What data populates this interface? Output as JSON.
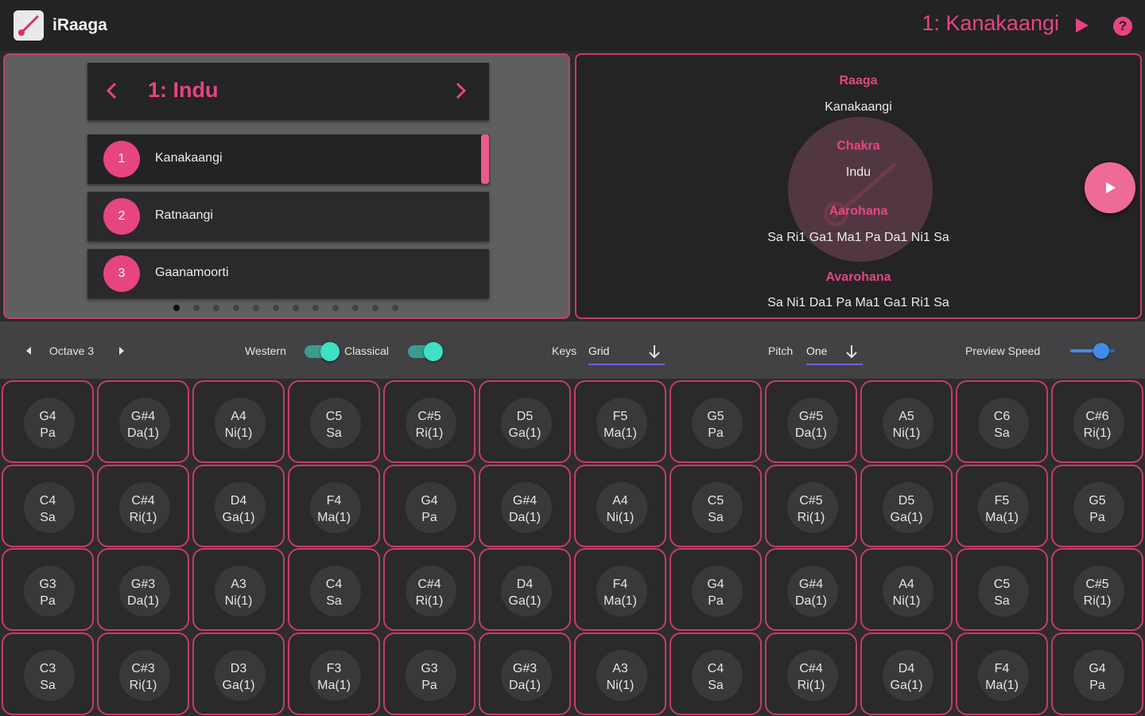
{
  "app": {
    "name": "iRaaga",
    "current_raaga": "1: Kanakaangi"
  },
  "chakra_nav": {
    "title": "1: Indu"
  },
  "raaga_list": [
    {
      "number": "1",
      "name": "Kanakaangi",
      "selected": true
    },
    {
      "number": "2",
      "name": "Ratnaangi",
      "selected": false
    },
    {
      "number": "3",
      "name": "Gaanamoorti",
      "selected": false
    }
  ],
  "pager": {
    "count": 12,
    "active_index": 0
  },
  "info": {
    "raaga_label": "Raaga",
    "raaga_value": "Kanakaangi",
    "chakra_label": "Chakra",
    "chakra_value": "Indu",
    "aarohana_label": "Aarohana",
    "aarohana_value": "Sa Ri1 Ga1 Ma1 Pa Da1 Ni1 Sa",
    "avarohana_label": "Avarohana",
    "avarohana_value": "Sa Ni1 Da1 Pa Ma1 Ga1  Ri1 Sa"
  },
  "controls": {
    "octave_label": "Octave 3",
    "western_label": "Western",
    "classical_label": "Classical",
    "keys_label": "Keys",
    "keys_value": "Grid",
    "pitch_label": "Pitch",
    "pitch_value": "One",
    "preview_speed_label": "Preview Speed",
    "preview_speed_fraction": 0.7
  },
  "colors": {
    "accent": "#e7457f",
    "toggle": "#3fe0c5",
    "slider": "#3f8de6",
    "dropdown_underline": "#7c5cd8"
  },
  "keys": [
    [
      [
        "G4",
        "Pa"
      ],
      [
        "G#4",
        "Da(1)"
      ],
      [
        "A4",
        "Ni(1)"
      ],
      [
        "C5",
        "Sa"
      ],
      [
        "C#5",
        "Ri(1)"
      ],
      [
        "D5",
        "Ga(1)"
      ],
      [
        "F5",
        "Ma(1)"
      ],
      [
        "G5",
        "Pa"
      ],
      [
        "G#5",
        "Da(1)"
      ],
      [
        "A5",
        "Ni(1)"
      ],
      [
        "C6",
        "Sa"
      ],
      [
        "C#6",
        "Ri(1)"
      ]
    ],
    [
      [
        "C4",
        "Sa"
      ],
      [
        "C#4",
        "Ri(1)"
      ],
      [
        "D4",
        "Ga(1)"
      ],
      [
        "F4",
        "Ma(1)"
      ],
      [
        "G4",
        "Pa"
      ],
      [
        "G#4",
        "Da(1)"
      ],
      [
        "A4",
        "Ni(1)"
      ],
      [
        "C5",
        "Sa"
      ],
      [
        "C#5",
        "Ri(1)"
      ],
      [
        "D5",
        "Ga(1)"
      ],
      [
        "F5",
        "Ma(1)"
      ],
      [
        "G5",
        "Pa"
      ]
    ],
    [
      [
        "G3",
        "Pa"
      ],
      [
        "G#3",
        "Da(1)"
      ],
      [
        "A3",
        "Ni(1)"
      ],
      [
        "C4",
        "Sa"
      ],
      [
        "C#4",
        "Ri(1)"
      ],
      [
        "D4",
        "Ga(1)"
      ],
      [
        "F4",
        "Ma(1)"
      ],
      [
        "G4",
        "Pa"
      ],
      [
        "G#4",
        "Da(1)"
      ],
      [
        "A4",
        "Ni(1)"
      ],
      [
        "C5",
        "Sa"
      ],
      [
        "C#5",
        "Ri(1)"
      ]
    ],
    [
      [
        "C3",
        "Sa"
      ],
      [
        "C#3",
        "Ri(1)"
      ],
      [
        "D3",
        "Ga(1)"
      ],
      [
        "F3",
        "Ma(1)"
      ],
      [
        "G3",
        "Pa"
      ],
      [
        "G#3",
        "Da(1)"
      ],
      [
        "A3",
        "Ni(1)"
      ],
      [
        "C4",
        "Sa"
      ],
      [
        "C#4",
        "Ri(1)"
      ],
      [
        "D4",
        "Ga(1)"
      ],
      [
        "F4",
        "Ma(1)"
      ],
      [
        "G4",
        "Pa"
      ]
    ]
  ]
}
